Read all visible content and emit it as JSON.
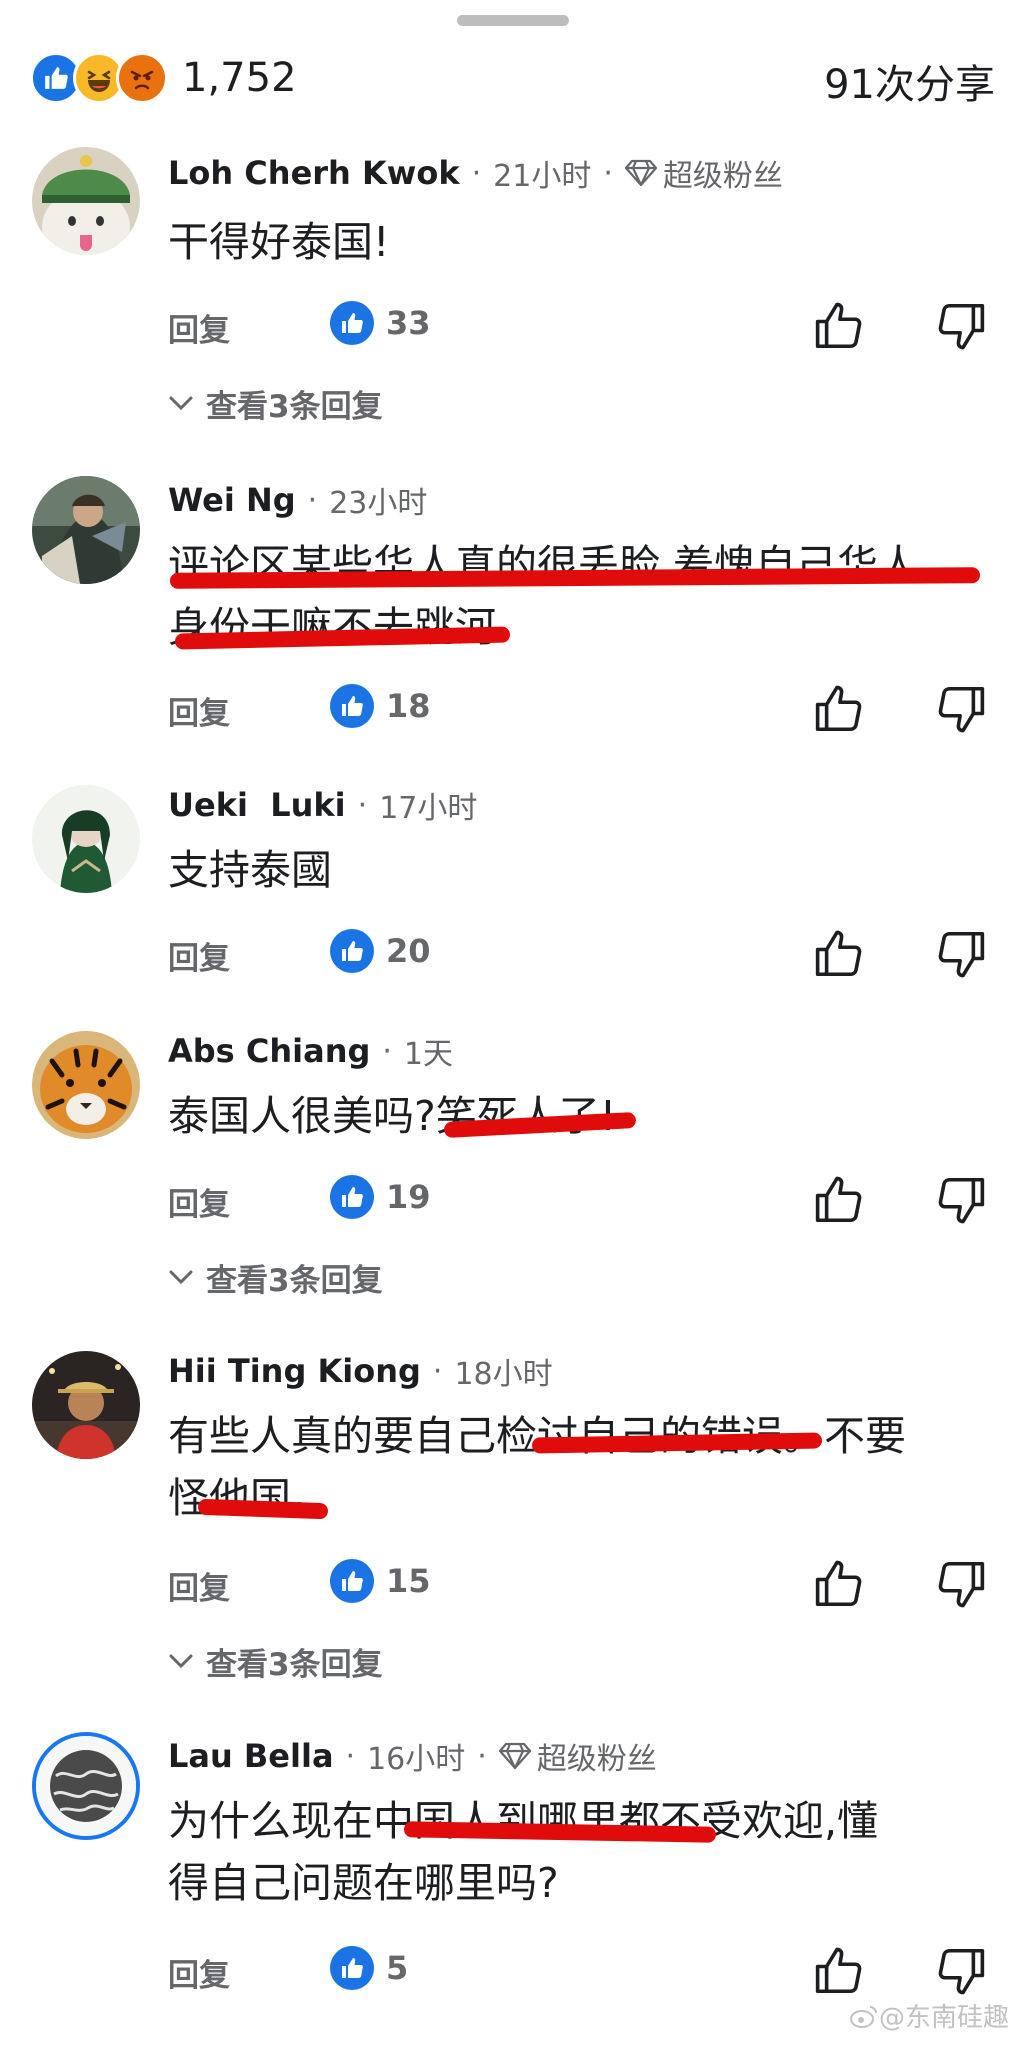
{
  "header": {
    "reaction_count": "1,752",
    "share_count": "91次分享",
    "reactions": [
      "like-icon",
      "haha-icon",
      "angry-icon"
    ]
  },
  "colors": {
    "accent": "#1b74e4",
    "strike": "#e00b0b",
    "muted": "#65676b"
  },
  "comments": [
    {
      "author": "Loh Cherh Kwok",
      "time": "21小时",
      "badge": "超级粉丝",
      "lines": [
        "干得好泰国!"
      ],
      "reply_label": "回复",
      "likes": "33",
      "view_replies": "查看3条回复"
    },
    {
      "author": "Wei Ng",
      "time": "23小时",
      "lines": [
        "评论区某些华人真的很丢脸 羞愧自己华人",
        "身份干嘛不去跳河"
      ],
      "reply_label": "回复",
      "likes": "18"
    },
    {
      "author": "Ueki  Luki",
      "time": "17小时",
      "lines": [
        "支持泰國"
      ],
      "reply_label": "回复",
      "likes": "20"
    },
    {
      "author": "Abs Chiang",
      "time": "1天",
      "lines": [
        "泰国人很美吗?笑死人了!"
      ],
      "reply_label": "回复",
      "likes": "19",
      "view_replies": "查看3条回复"
    },
    {
      "author": "Hii Ting Kiong",
      "time": "18小时",
      "lines": [
        "有些人真的要自己检讨自己的错误。不要",
        "怪他国。"
      ],
      "reply_label": "回复",
      "likes": "15",
      "view_replies": "查看3条回复"
    },
    {
      "author": "Lau Bella",
      "time": "16小时",
      "badge": "超级粉丝",
      "lines": [
        "为什么现在中国人到哪里都不受欢迎,懂",
        "得自己问题在哪里吗?"
      ],
      "reply_label": "回复",
      "likes": "5"
    }
  ],
  "watermark": "@东南硅趣"
}
